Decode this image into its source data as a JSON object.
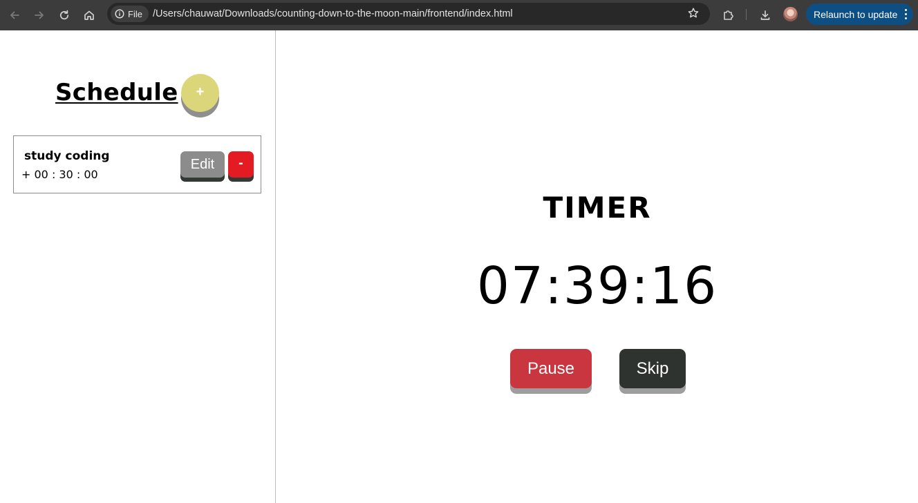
{
  "browser": {
    "site_chip_label": "File",
    "url": "/Users/chauwat/Downloads/counting-down-to-the-moon-main/frontend/index.html",
    "relaunch_label": "Relaunch to update",
    "icons": {
      "back": "arrow-left-icon",
      "forward": "arrow-right-icon",
      "reload": "reload-icon",
      "home": "home-icon",
      "info": "info-icon",
      "bookmark": "star-icon",
      "extensions": "puzzle-icon",
      "downloads": "download-icon",
      "menu": "kebab-icon"
    }
  },
  "schedule": {
    "title": "Schedule",
    "add_label": "+",
    "items": [
      {
        "name": "study coding",
        "duration": "+ 00 : 30 : 00",
        "edit_label": "Edit",
        "remove_label": "-"
      }
    ]
  },
  "timer": {
    "title": "TIMER",
    "display": "07:39:16",
    "pause_label": "Pause",
    "skip_label": "Skip"
  },
  "colors": {
    "add_button": "#dcd67a",
    "edit_button": "#8c8c8c",
    "remove_button": "#e41b23",
    "pause_button": "#c9363f",
    "skip_button": "#2e332f",
    "relaunch_button": "#0d4f82"
  }
}
